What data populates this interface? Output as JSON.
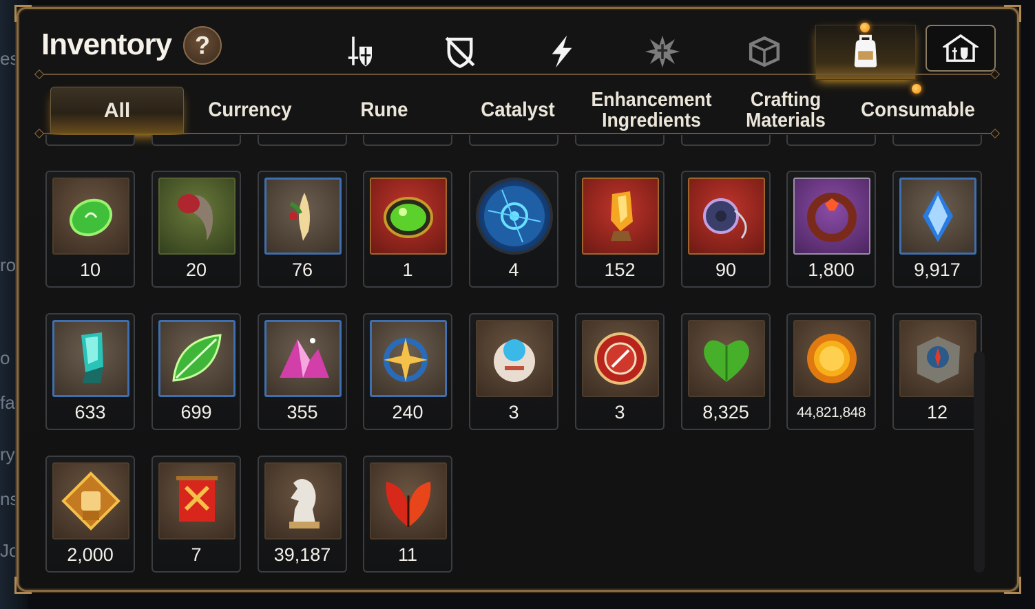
{
  "window": {
    "title": "Inventory",
    "help_label": "?"
  },
  "category_tabs": [
    {
      "name": "gear",
      "icon": "sword-shield-icon"
    },
    {
      "name": "artifact",
      "icon": "broken-shield-icon"
    },
    {
      "name": "skill",
      "icon": "lightning-icon"
    },
    {
      "name": "sigil",
      "icon": "burst-emblem-icon"
    },
    {
      "name": "cube",
      "icon": "cube-icon"
    },
    {
      "name": "items",
      "icon": "backpack-icon",
      "active": true
    },
    {
      "name": "storage",
      "icon": "guild-house-icon"
    }
  ],
  "sub_tabs": [
    {
      "label": "All",
      "active": true
    },
    {
      "label": "Currency"
    },
    {
      "label": "Rune"
    },
    {
      "label": "Catalyst"
    },
    {
      "label": "Enhancement Ingredients"
    },
    {
      "label": "Crafting Materials"
    },
    {
      "label": "Consumable"
    }
  ],
  "items_rows": [
    [
      {
        "qty": "10",
        "icon": "green-gem-icon",
        "bg": "brown"
      },
      {
        "qty": "20",
        "icon": "claw-icon",
        "bg": "green"
      },
      {
        "qty": "76",
        "icon": "ginseng-root-icon",
        "bg": "blue"
      },
      {
        "qty": "1",
        "icon": "green-orb-icon",
        "bg": "red"
      },
      {
        "qty": "4",
        "icon": "rune-portal-icon",
        "bg": "round"
      },
      {
        "qty": "152",
        "icon": "fire-crystal-icon",
        "bg": "red"
      },
      {
        "qty": "90",
        "icon": "pendant-icon",
        "bg": "red"
      },
      {
        "qty": "1,800",
        "icon": "ring-icon",
        "bg": "purple"
      },
      {
        "qty": "9,917",
        "icon": "blue-crystal-icon",
        "bg": "blue"
      }
    ],
    [
      {
        "qty": "633",
        "icon": "cyan-crystal-icon",
        "bg": "blue"
      },
      {
        "qty": "699",
        "icon": "glowing-leaf-icon",
        "bg": "blue"
      },
      {
        "qty": "355",
        "icon": "pink-crystals-icon",
        "bg": "blue"
      },
      {
        "qty": "240",
        "icon": "star-amulet-icon",
        "bg": "blue"
      },
      {
        "qty": "3",
        "icon": "capsule-device-icon",
        "bg": "brown"
      },
      {
        "qty": "3",
        "icon": "red-medal-icon",
        "bg": "brown"
      },
      {
        "qty": "8,325",
        "icon": "green-heart-icon",
        "bg": "brown"
      },
      {
        "qty": "44,821,848",
        "icon": "gold-coin-icon",
        "bg": "brown"
      },
      {
        "qty": "12",
        "icon": "compass-box-icon",
        "bg": "brown"
      }
    ],
    [
      {
        "qty": "2,000",
        "icon": "fist-badge-icon",
        "bg": "brown"
      },
      {
        "qty": "7",
        "icon": "war-banner-icon",
        "bg": "brown"
      },
      {
        "qty": "39,187",
        "icon": "chess-knight-icon",
        "bg": "brown"
      },
      {
        "qty": "11",
        "icon": "red-leaves-icon",
        "bg": "brown"
      }
    ]
  ],
  "colors": {
    "frame_gold": "#8a6c43",
    "active_glow": "#d49a2a",
    "panel_bg": "#121212"
  }
}
